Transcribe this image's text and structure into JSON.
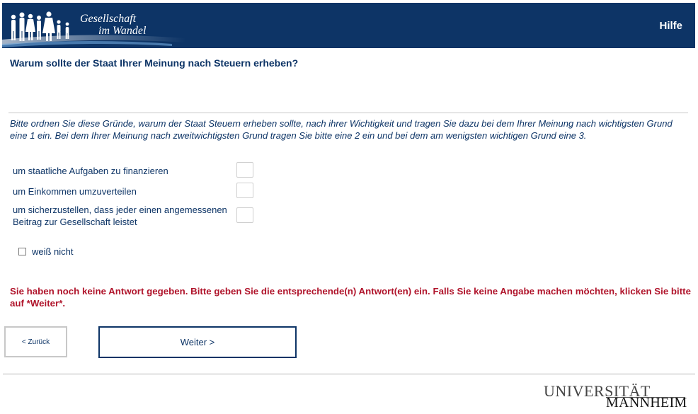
{
  "header": {
    "logo_line1": "Gesellschaft",
    "logo_line2": "im Wandel",
    "help_label": "Hilfe",
    "bg_color": "#0d3466"
  },
  "question": {
    "title": "Warum sollte der Staat Ihrer Meinung nach Steuern erheben?",
    "instruction": "Bitte ordnen Sie diese Gründe, warum der Staat Steuern erheben sollte, nach ihrer Wichtigkeit und tragen Sie dazu bei dem Ihrer Meinung nach wichtigsten Grund eine 1 ein. Bei dem Ihrer Meinung nach zweitwichtigsten Grund tragen Sie bitte eine 2 ein und bei dem am wenigsten wichtigen Grund eine 3.",
    "items": [
      {
        "label": "um staatliche Aufgaben zu finanzieren",
        "value": ""
      },
      {
        "label": "um Einkommen umzuverteilen",
        "value": ""
      },
      {
        "label": "um sicherzustellen, dass jeder einen angemessenen Beitrag zur Gesellschaft leistet",
        "value": ""
      }
    ],
    "dont_know_label": "weiß nicht",
    "dont_know_checked": false
  },
  "error": {
    "message": "Sie haben noch keine Antwort gegeben. Bitte geben Sie die entsprechende(n) Antwort(en) ein. Falls Sie keine Angabe machen möchten, klicken Sie bitte auf *Weiter*.",
    "color": "#b0142b"
  },
  "nav": {
    "back_label": "< Zurück",
    "next_label": "Weiter >"
  },
  "footer": {
    "logo_line1": "UNIVERSITÄT",
    "logo_line2": "MANNHEIM"
  }
}
